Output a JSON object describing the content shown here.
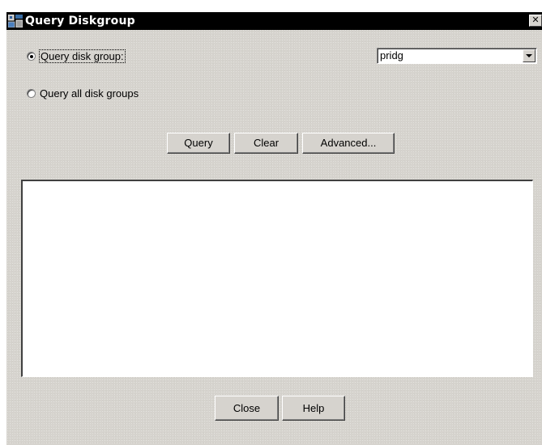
{
  "window": {
    "title": "Query Diskgroup",
    "close_glyph": "✕"
  },
  "options": {
    "query_disk_group_label": "Query disk group:",
    "query_disk_group_checked": true,
    "query_all_label": "Query all disk groups",
    "query_all_checked": false
  },
  "diskgroup_select": {
    "selected": "pridg"
  },
  "actions": {
    "query_label": "Query",
    "clear_label": "Clear",
    "advanced_label": "Advanced..."
  },
  "output": {
    "text": ""
  },
  "footer": {
    "close_label": "Close",
    "help_label": "Help"
  },
  "colors": {
    "dialog_background": "#d6d3ce",
    "titlebar_background": "#000000",
    "titlebar_text": "#ffffff"
  },
  "icons": {
    "title": "disk-group-icon",
    "close": "close-icon",
    "dropdown": "chevron-down-icon"
  }
}
